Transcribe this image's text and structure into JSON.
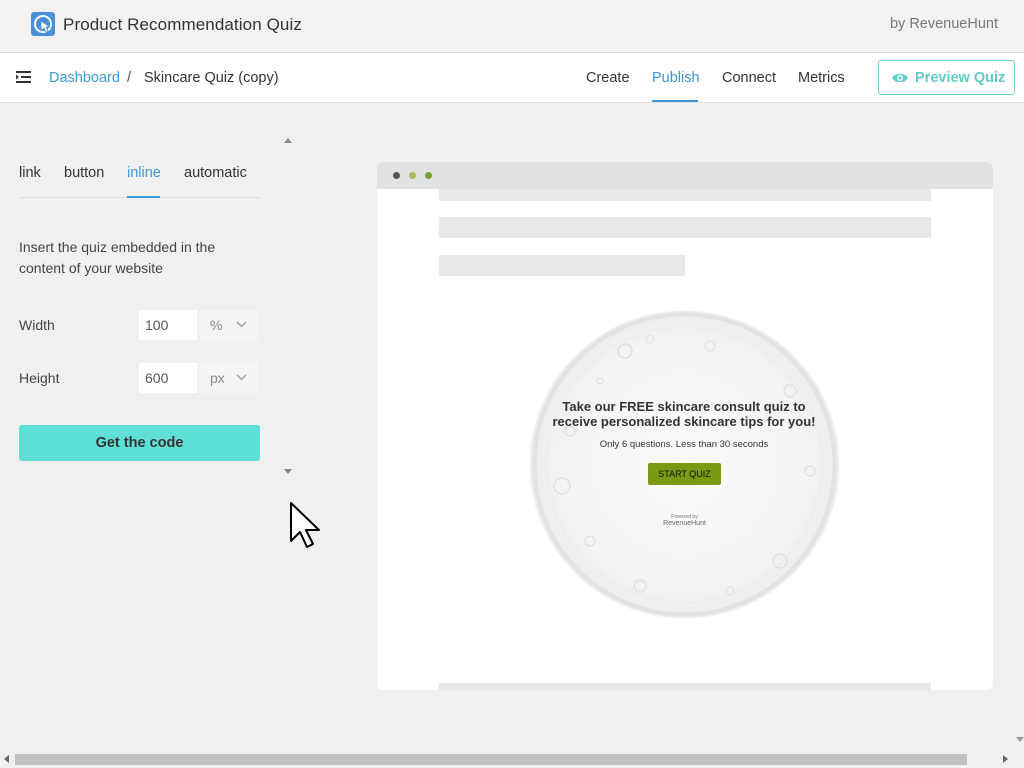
{
  "app": {
    "title": "Product Recommendation Quiz",
    "by": "by RevenueHunt",
    "logo_icon": "quiz-cursor-logo-icon"
  },
  "nav": {
    "breadcrumb_root": "Dashboard",
    "breadcrumb_sep": "/",
    "breadcrumb_current": "Skincare Quiz (copy)",
    "tabs": [
      {
        "label": "Create",
        "active": false
      },
      {
        "label": "Publish",
        "active": true
      },
      {
        "label": "Connect",
        "active": false
      },
      {
        "label": "Metrics",
        "active": false
      }
    ],
    "preview_label": "Preview Quiz"
  },
  "publish": {
    "tabs": [
      {
        "label": "link",
        "active": false
      },
      {
        "label": "button",
        "active": false
      },
      {
        "label": "inline",
        "active": true
      },
      {
        "label": "automatic",
        "active": false
      }
    ],
    "description": "Insert the quiz embedded in the content of your website",
    "width": {
      "label": "Width",
      "value": "100",
      "unit": "%"
    },
    "height": {
      "label": "Height",
      "value": "600",
      "unit": "px"
    },
    "get_code_label": "Get the code"
  },
  "preview": {
    "window_dots": [
      "#555555",
      "#b6b460",
      "#77a02e"
    ],
    "quiz_title": "Take our FREE skincare consult quiz to receive personalized skincare tips for you!",
    "quiz_subtitle": "Only 6 questions. Less than 30 seconds",
    "start_label": "START QUIZ",
    "powered_by": "Powered by",
    "powered_brand": "RevenueHunt"
  },
  "colors": {
    "accent": "#3a9ad9",
    "teal": "#5fe0d6",
    "quiz_button": "#7a9a14"
  }
}
